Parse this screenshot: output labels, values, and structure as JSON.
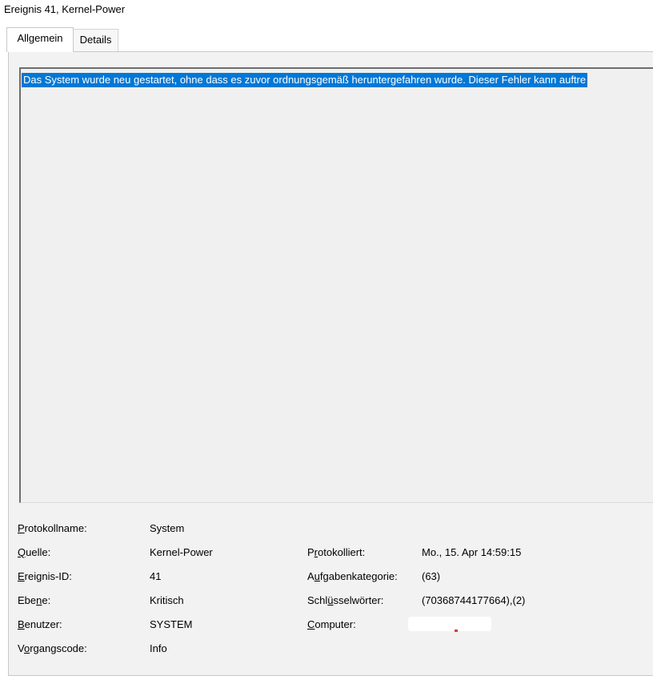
{
  "window": {
    "title": "Ereignis 41, Kernel-Power"
  },
  "tabs": {
    "general": "Allgemein",
    "details": "Details"
  },
  "description": "Das System wurde neu gestartet, ohne dass es zuvor ordnungsgemäß heruntergefahren wurde. Dieser Fehler kann auftre",
  "fields": {
    "log_name": {
      "k": "P",
      "rest": "rotokollname:",
      "value": "System"
    },
    "source": {
      "k": "Q",
      "rest": "uelle:",
      "value": "Kernel-Power"
    },
    "event_id": {
      "k": "E",
      "rest": "reignis-ID:",
      "value": "41"
    },
    "level": {
      "pre": "Ebe",
      "k": "n",
      "rest": "e:",
      "value": "Kritisch"
    },
    "user": {
      "k": "B",
      "rest": "enutzer:",
      "value": "SYSTEM"
    },
    "opcode": {
      "pre": "V",
      "k": "o",
      "rest": "rgangscode:",
      "value": "Info"
    },
    "logged": {
      "pre": "P",
      "k": "r",
      "rest": "otokolliert:",
      "value": "Mo., 15. Apr 14:59:15"
    },
    "task_category": {
      "pre": "A",
      "k": "u",
      "rest": "fgabenkategorie:",
      "value": "(63)"
    },
    "keywords": {
      "pre": "Schl",
      "k": "ü",
      "rest": "sselwörter:",
      "value": "(70368744177664),(2)"
    },
    "computer": {
      "k": "C",
      "rest": "omputer:",
      "value": ""
    }
  }
}
